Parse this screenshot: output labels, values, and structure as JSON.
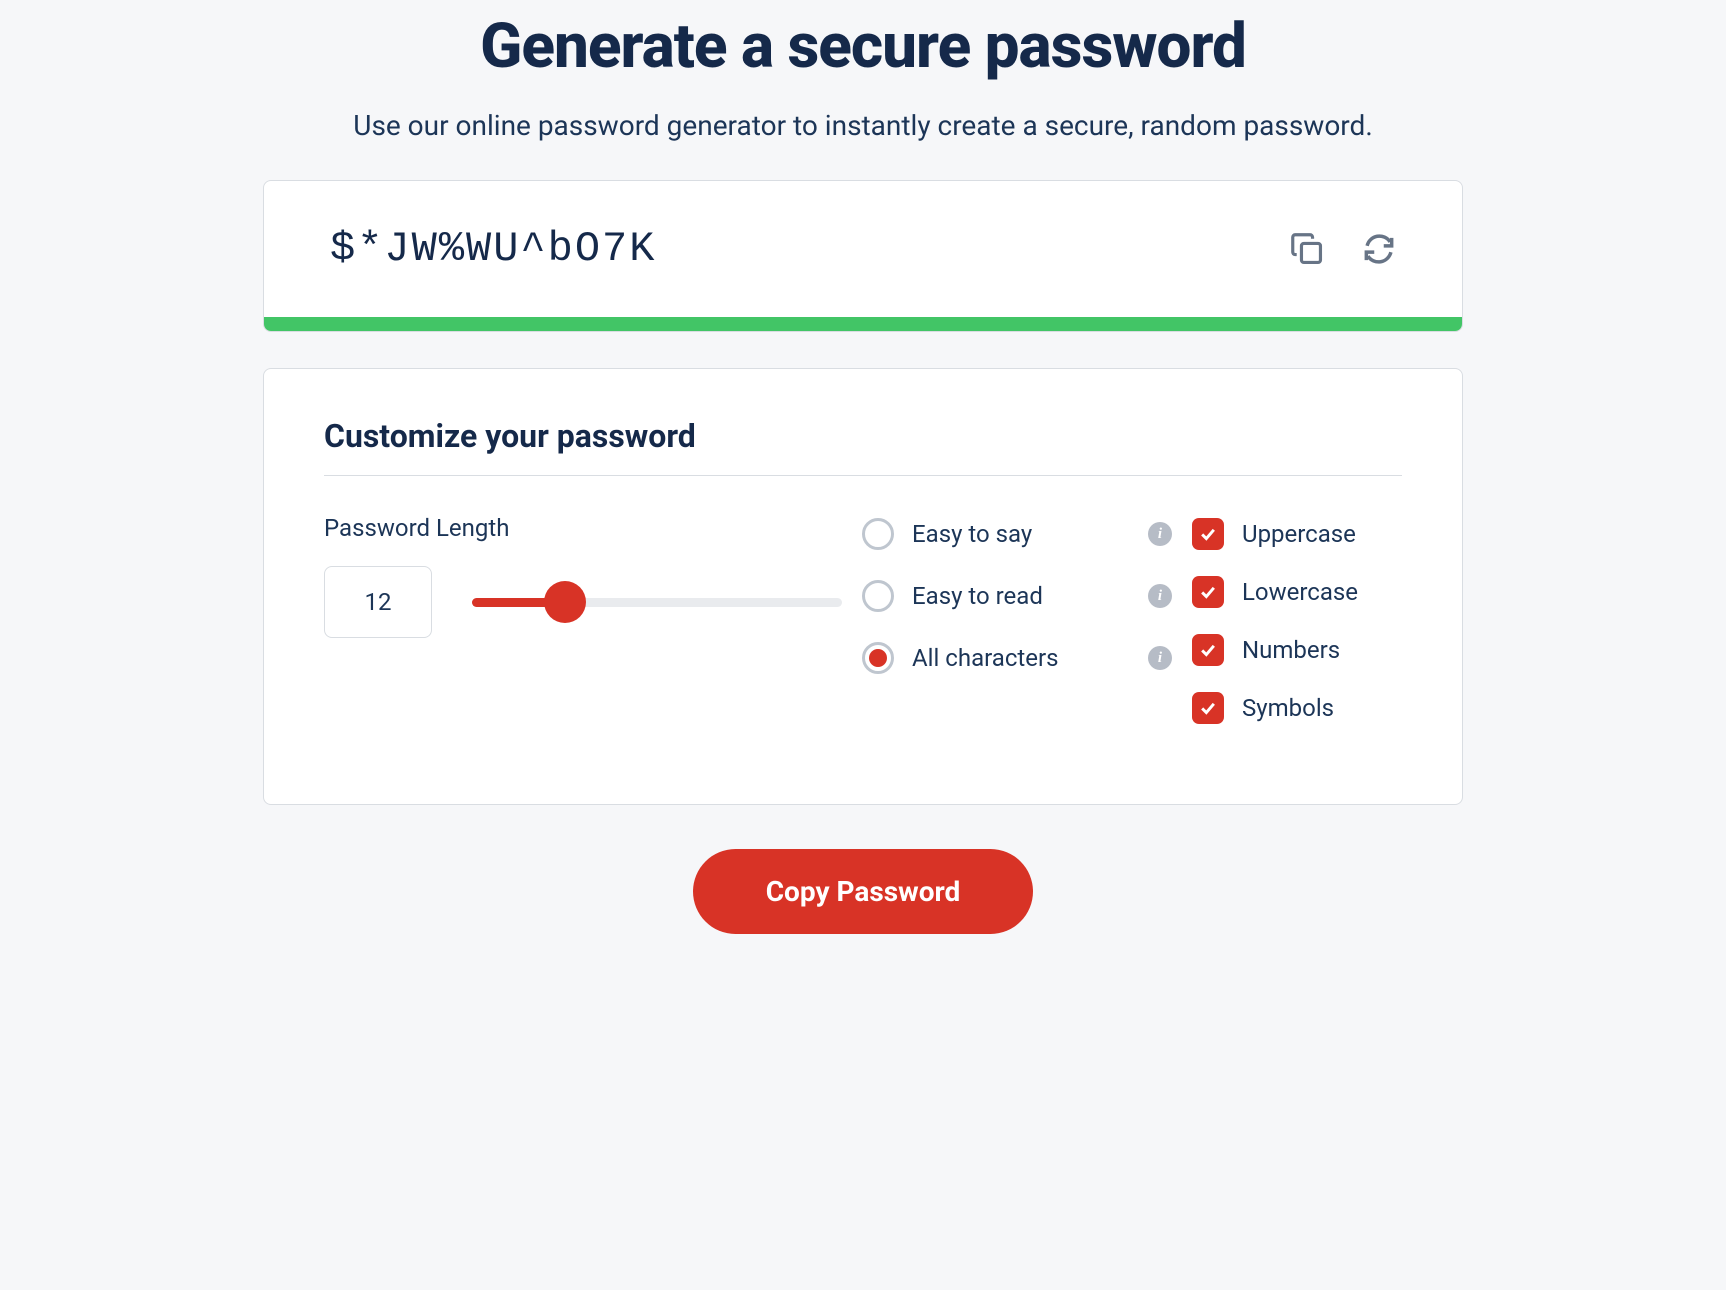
{
  "header": {
    "title": "Generate a secure password",
    "subtitle": "Use our online password generator to instantly create a secure, random password."
  },
  "password": {
    "value": "$*JW%WU^bO7K",
    "strength_color": "#42c566"
  },
  "icons": {
    "copy": "copy-icon",
    "refresh": "refresh-icon"
  },
  "customize": {
    "title": "Customize your password",
    "length_label": "Password Length",
    "length_value": "12",
    "slider": {
      "min": 1,
      "max": 50,
      "value": 12,
      "percent": 25
    },
    "modes": [
      {
        "key": "easy_say",
        "label": "Easy to say",
        "checked": false,
        "info": true
      },
      {
        "key": "easy_read",
        "label": "Easy to read",
        "checked": false,
        "info": true
      },
      {
        "key": "all_chars",
        "label": "All characters",
        "checked": true,
        "info": true
      }
    ],
    "charsets": [
      {
        "key": "uppercase",
        "label": "Uppercase",
        "checked": true
      },
      {
        "key": "lowercase",
        "label": "Lowercase",
        "checked": true
      },
      {
        "key": "numbers",
        "label": "Numbers",
        "checked": true
      },
      {
        "key": "symbols",
        "label": "Symbols",
        "checked": true
      }
    ]
  },
  "actions": {
    "copy_button": "Copy Password"
  }
}
